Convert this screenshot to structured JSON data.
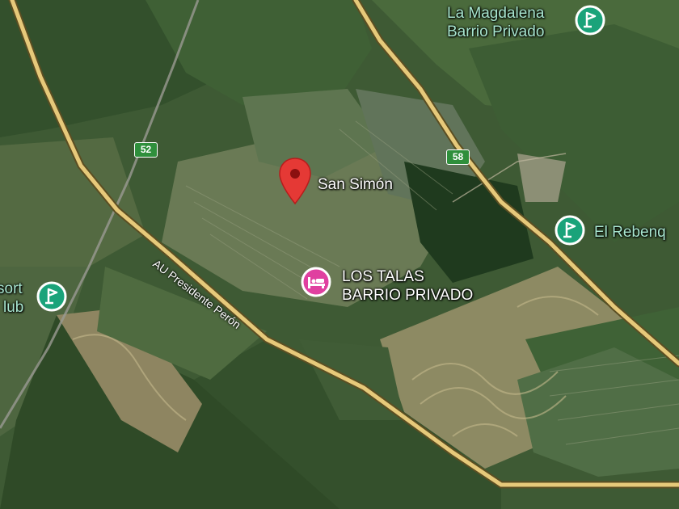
{
  "map": {
    "view": "satellite",
    "roads": [
      {
        "name": "AU Presidente Perón"
      }
    ],
    "route_shields": [
      {
        "number": "52",
        "color": "#2f8f3c"
      },
      {
        "number": "58",
        "color": "#2f8f3c"
      }
    ],
    "pins": [
      {
        "label": "San Simón",
        "icon": "map-pin-icon",
        "color": "#e53935"
      }
    ],
    "places": [
      {
        "line1": "La Magdalena",
        "line2": "Barrio Privado",
        "icon": "golf-icon",
        "color": "#1aa37a"
      },
      {
        "line1": "El Rebenq",
        "icon": "golf-icon",
        "color": "#1aa37a"
      },
      {
        "line1": "sort",
        "line2": "lub",
        "icon": "golf-icon",
        "color": "#1aa37a"
      },
      {
        "line1": "LOS TALAS",
        "line2": "BARRIO PRIVADO",
        "icon": "hotel-icon",
        "color": "#e040a0"
      }
    ]
  }
}
